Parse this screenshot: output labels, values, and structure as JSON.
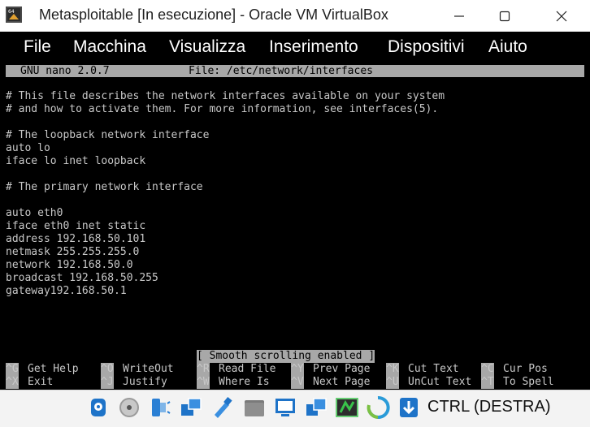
{
  "window": {
    "title": "Metasploitable [In esecuzione] - Oracle VM VirtualBox",
    "icon": "virtualbox-icon",
    "controls": [
      "minimize-icon",
      "maximize-icon",
      "close-icon"
    ]
  },
  "menu": {
    "items": [
      "File",
      "Macchina",
      "Visualizza",
      "Inserimento",
      "Dispositivi",
      "Aiuto"
    ]
  },
  "nano": {
    "version": "GNU nano 2.0.7",
    "file_label": "File: /etc/network/interfaces",
    "lines": [
      "# This file describes the network interfaces available on your system",
      "# and how to activate them. For more information, see interfaces(5).",
      "",
      "# The loopback network interface",
      "auto lo",
      "iface lo inet loopback",
      "",
      "# The primary network interface",
      "",
      "auto eth0",
      "iface eth0 inet static",
      "address 192.168.50.101",
      "netmask 255.255.255.0",
      "network 192.168.50.0",
      "broadcast 192.168.50.255",
      "gateway192.168.50.1"
    ],
    "status_message": "[ Smooth scrolling enabled ]",
    "shortcuts_row1": [
      {
        "key": "^G",
        "label": "Get Help"
      },
      {
        "key": "^O",
        "label": "WriteOut"
      },
      {
        "key": "^R",
        "label": "Read File"
      },
      {
        "key": "^Y",
        "label": "Prev Page"
      },
      {
        "key": "^K",
        "label": "Cut Text"
      },
      {
        "key": "^C",
        "label": "Cur Pos"
      }
    ],
    "shortcuts_row2": [
      {
        "key": "^X",
        "label": "Exit"
      },
      {
        "key": "^J",
        "label": "Justify"
      },
      {
        "key": "^W",
        "label": "Where Is"
      },
      {
        "key": "^V",
        "label": "Next Page"
      },
      {
        "key": "^U",
        "label": "UnCut Text"
      },
      {
        "key": "^T",
        "label": "To Spell"
      }
    ]
  },
  "statusbar": {
    "icons": [
      "hard-disk-icon",
      "optical-drive-icon",
      "audio-icon",
      "network-icon",
      "usb-icon",
      "shared-folder-icon",
      "display-icon",
      "video-capture-icon",
      "recording-icon",
      "guest-additions-icon",
      "mouse-integration-icon",
      "keyboard-capture-icon"
    ],
    "host_key": "CTRL (DESTRA)"
  }
}
